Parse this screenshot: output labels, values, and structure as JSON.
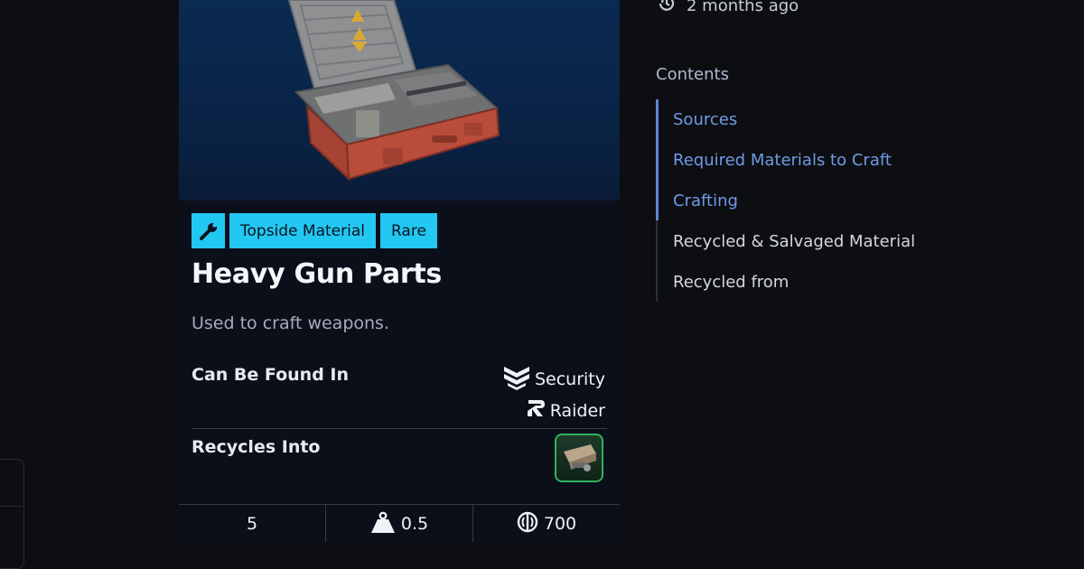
{
  "sidebar_meta": {
    "updated_text": "2 months ago"
  },
  "item": {
    "tags": [
      "Topside Material",
      "Rare"
    ],
    "name": "Heavy Gun Parts",
    "description": "Used to craft weapons.",
    "found_in_label": "Can Be Found In",
    "found_in": [
      {
        "name": "Security",
        "icon": "security-chevrons-icon"
      },
      {
        "name": "Raider",
        "icon": "raider-icon"
      }
    ],
    "recycles_label": "Recycles Into",
    "stats": {
      "stack": "5",
      "weight": "0.5",
      "value": "700"
    }
  },
  "toc": {
    "title": "Contents",
    "items": [
      {
        "label": "Sources",
        "active": true
      },
      {
        "label": "Required Materials to Craft",
        "active": true
      },
      {
        "label": "Crafting",
        "active": true
      },
      {
        "label": "Recycled & Salvaged Material",
        "active": false
      },
      {
        "label": "Recycled from",
        "active": false
      }
    ]
  },
  "colors": {
    "tag_bg": "#22c7f2",
    "active_link": "#6f9be6",
    "recycle_border": "#2fb35d"
  }
}
